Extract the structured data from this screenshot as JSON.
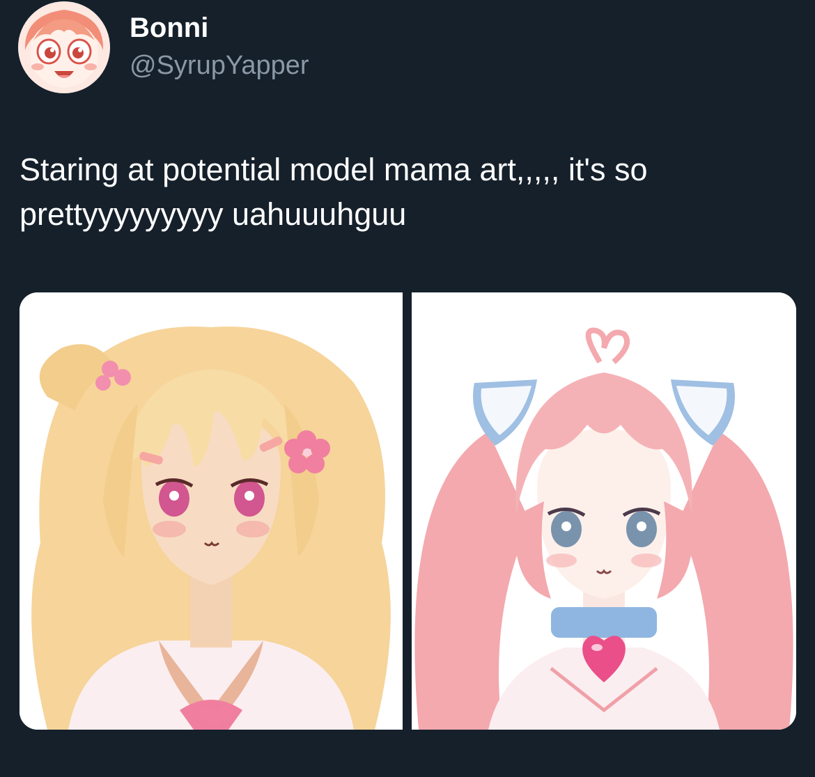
{
  "tweet": {
    "author": {
      "display_name": "Bonni",
      "handle": "@SyrupYapper",
      "avatar_icon": "avatar-anime-character-icon"
    },
    "text": "Staring at potential model mama art,,,,, it's so prettyyyyyyyyy uahuuuhguu",
    "media": [
      {
        "name": "blonde-anime-girl-pink-flowers-illustration",
        "palette": {
          "hair": "#f7d9a0",
          "eyes": "#d2568f",
          "accent": "#f07fa0"
        }
      },
      {
        "name": "pink-twintail-anime-girl-heart-collar-illustration",
        "palette": {
          "hair": "#f3a9ae",
          "eyes": "#7a93ad",
          "accent": "#ea4f8a"
        }
      }
    ]
  },
  "theme": {
    "background": "#15202b",
    "text": "#ffffff",
    "secondary_text": "#8b98a5"
  }
}
